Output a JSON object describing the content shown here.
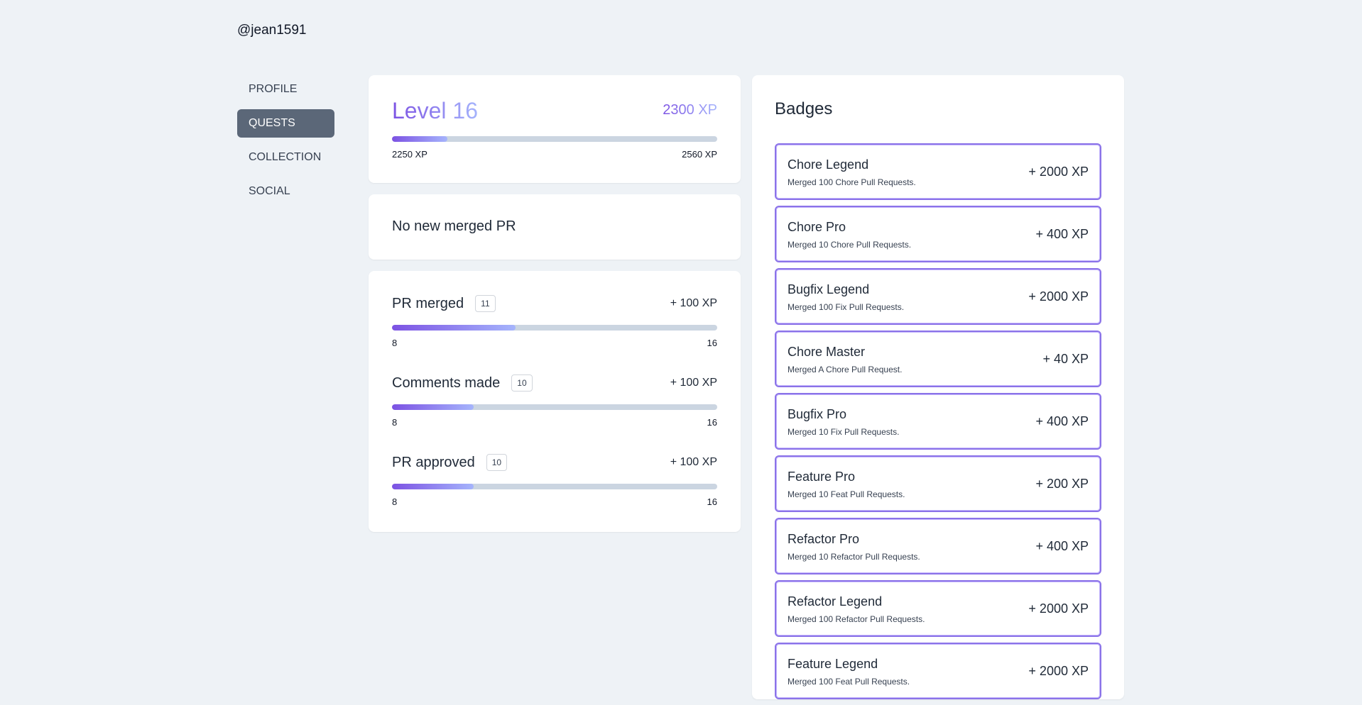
{
  "user": {
    "handle": "@jean1591"
  },
  "nav": [
    {
      "label": "PROFILE",
      "active": false
    },
    {
      "label": "QUESTS",
      "active": true
    },
    {
      "label": "COLLECTION",
      "active": false
    },
    {
      "label": "SOCIAL",
      "active": false
    }
  ],
  "level": {
    "title": "Level 16",
    "xp": "2300 XP",
    "min": "2250 XP",
    "max": "2560 XP",
    "progress": 0.17
  },
  "pr_status": {
    "text": "No new merged PR"
  },
  "quests": [
    {
      "title": "PR merged",
      "count": "11",
      "xp": "+ 100 XP",
      "min": "8",
      "max": "16",
      "progress": 0.38
    },
    {
      "title": "Comments made",
      "count": "10",
      "xp": "+ 100 XP",
      "min": "8",
      "max": "16",
      "progress": 0.25
    },
    {
      "title": "PR approved",
      "count": "10",
      "xp": "+ 100 XP",
      "min": "8",
      "max": "16",
      "progress": 0.25
    }
  ],
  "badges": {
    "title": "Badges",
    "items": [
      {
        "name": "Chore Legend",
        "desc": "Merged 100 Chore Pull Requests.",
        "xp": "+ 2000 XP"
      },
      {
        "name": "Chore Pro",
        "desc": "Merged 10 Chore Pull Requests.",
        "xp": "+ 400 XP"
      },
      {
        "name": "Bugfix Legend",
        "desc": "Merged 100 Fix Pull Requests.",
        "xp": "+ 2000 XP"
      },
      {
        "name": "Chore Master",
        "desc": "Merged A Chore Pull Request.",
        "xp": "+ 40 XP"
      },
      {
        "name": "Bugfix Pro",
        "desc": "Merged 10 Fix Pull Requests.",
        "xp": "+ 400 XP"
      },
      {
        "name": "Feature Pro",
        "desc": "Merged 10 Feat Pull Requests.",
        "xp": "+ 200 XP"
      },
      {
        "name": "Refactor Pro",
        "desc": "Merged 10 Refactor Pull Requests.",
        "xp": "+ 400 XP"
      },
      {
        "name": "Refactor Legend",
        "desc": "Merged 100 Refactor Pull Requests.",
        "xp": "+ 2000 XP"
      },
      {
        "name": "Feature Legend",
        "desc": "Merged 100 Feat Pull Requests.",
        "xp": "+ 2000 XP"
      }
    ]
  },
  "colors": {
    "accent_start": "#7c52e3",
    "accent_end": "#a5b4fc",
    "active_nav": "#5b6778",
    "background": "#eef2f6"
  }
}
